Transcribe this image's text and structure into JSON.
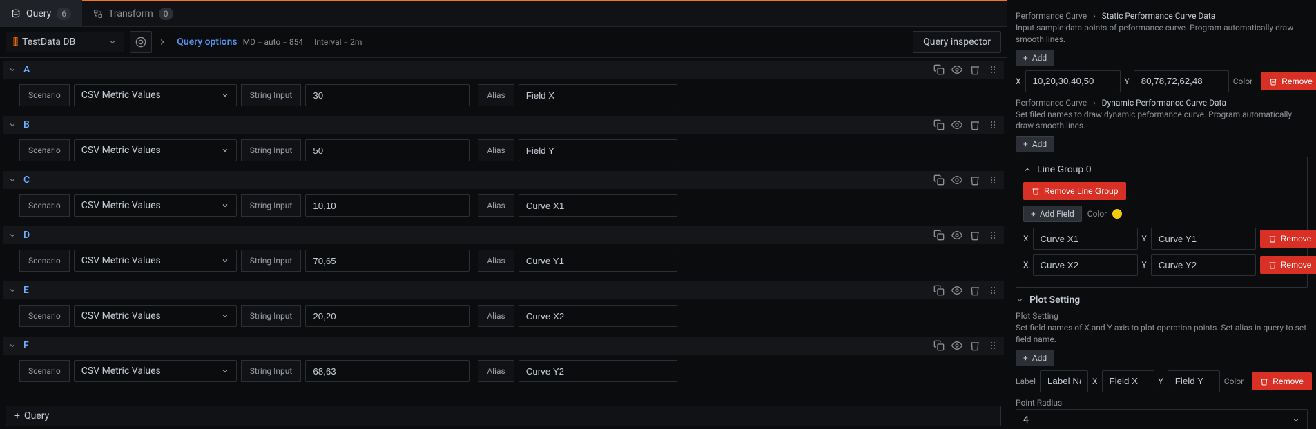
{
  "tabs": {
    "query": {
      "label": "Query",
      "count": "6"
    },
    "transform": {
      "label": "Transform",
      "count": "0"
    }
  },
  "toolbar": {
    "datasource": "TestData DB",
    "queryOptions": "Query options",
    "md": "MD = auto = 854",
    "interval": "Interval = 2m",
    "inspector": "Query inspector"
  },
  "queries": [
    {
      "id": "A",
      "scenarioLabel": "Scenario",
      "scenario": "CSV Metric Values",
      "stringInputLabel": "String Input",
      "stringInput": "30",
      "aliasLabel": "Alias",
      "alias": "Field X"
    },
    {
      "id": "B",
      "scenarioLabel": "Scenario",
      "scenario": "CSV Metric Values",
      "stringInputLabel": "String Input",
      "stringInput": "50",
      "aliasLabel": "Alias",
      "alias": "Field Y"
    },
    {
      "id": "C",
      "scenarioLabel": "Scenario",
      "scenario": "CSV Metric Values",
      "stringInputLabel": "String Input",
      "stringInput": "10,10",
      "aliasLabel": "Alias",
      "alias": "Curve X1"
    },
    {
      "id": "D",
      "scenarioLabel": "Scenario",
      "scenario": "CSV Metric Values",
      "stringInputLabel": "String Input",
      "stringInput": "70,65",
      "aliasLabel": "Alias",
      "alias": "Curve Y1"
    },
    {
      "id": "E",
      "scenarioLabel": "Scenario",
      "scenario": "CSV Metric Values",
      "stringInputLabel": "String Input",
      "stringInput": "20,20",
      "aliasLabel": "Alias",
      "alias": "Curve X2"
    },
    {
      "id": "F",
      "scenarioLabel": "Scenario",
      "scenario": "CSV Metric Values",
      "stringInputLabel": "String Input",
      "stringInput": "68,63",
      "aliasLabel": "Alias",
      "alias": "Curve Y2"
    }
  ],
  "addQueryLabel": "Query",
  "panel": {
    "staticCrumb": {
      "root": "Performance Curve",
      "current": "Static Performance Curve Data"
    },
    "staticDesc": "Input sample data points of peformance curve. Program automatically draw smooth lines.",
    "addLabel": "Add",
    "xLabel": "X",
    "yLabel": "Y",
    "staticX": "10,20,30,40,50",
    "staticY": "80,78,72,62,48",
    "colorLabel": "Color",
    "removeLabel": "Remove",
    "staticColor": "#8e9297",
    "dynamicCrumb": {
      "root": "Performance Curve",
      "current": "Dynamic Performance Curve Data"
    },
    "dynamicDesc": "Set filed names to draw dynamic peformance curve. Program automatically draw smooth lines.",
    "lineGroupTitle": "Line Group 0",
    "removeLineGroup": "Remove Line Group",
    "addField": "Add Field",
    "lineGroupColor": "#f2cc0c",
    "lines": [
      {
        "x": "Curve X1",
        "y": "Curve Y1"
      },
      {
        "x": "Curve X2",
        "y": "Curve Y2"
      }
    ],
    "plotSettingTitle": "Plot Setting",
    "plotSettingSub": "Plot Setting",
    "plotSettingDesc": "Set field names of X and Y axis to plot operation points. Set alias in query to set field name.",
    "labelLabel": "Label",
    "plotLabel": "Label Nan",
    "plotX": "Field X",
    "plotY": "Field Y",
    "plotColor": "#e02f44",
    "pointRadiusLabel": "Point Radius",
    "pointRadius": "4"
  }
}
